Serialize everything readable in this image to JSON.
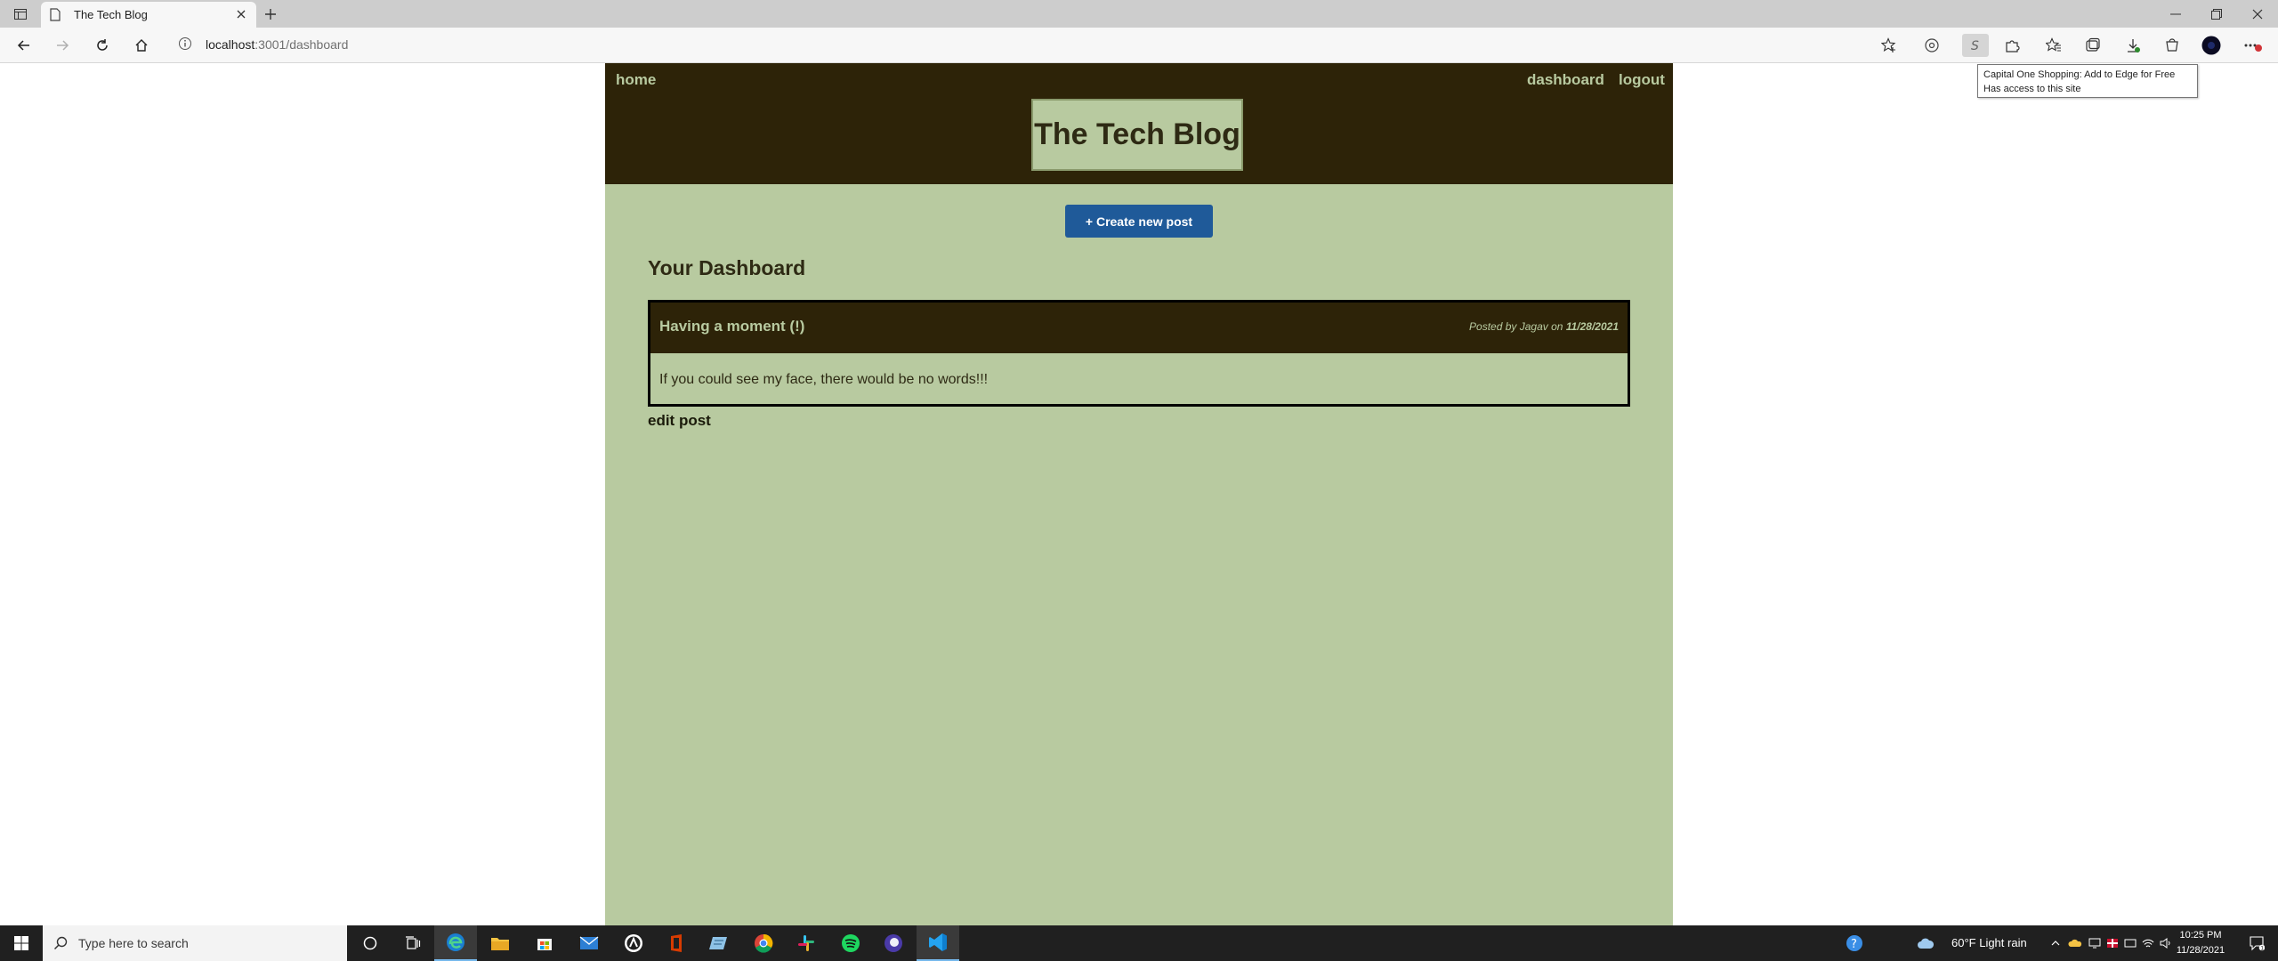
{
  "browser": {
    "tab_title": "The Tech Blog",
    "url_host": "localhost",
    "url_path": ":3001/dashboard",
    "extension_tooltip": {
      "line1": "Capital One Shopping: Add to Edge for Free",
      "line2": "Has access to this site"
    },
    "accent_color": "#1f5a99"
  },
  "site": {
    "nav": {
      "home": "home",
      "dashboard": "dashboard",
      "logout": "logout"
    },
    "title": "The Tech Blog",
    "create_button": "+ Create new post",
    "dashboard_title": "Your Dashboard",
    "posts": [
      {
        "title": "Having a moment (!)",
        "posted_by_prefix": "Posted by",
        "author": "Jagav",
        "on_word": "on",
        "date": "11/28/2021",
        "body": "If you could see my face, there would be no words!!!"
      }
    ],
    "edit_link": "edit post",
    "colors": {
      "header_bg": "#2d2308",
      "page_bg": "#b8caa0",
      "button_bg": "#1f5a99"
    }
  },
  "taskbar": {
    "search_placeholder": "Type here to search",
    "weather": "60°F  Light rain",
    "time": "10:25 PM",
    "date": "11/28/2021",
    "pinned_icons": [
      "cortana-icon",
      "task-view-icon",
      "edge-icon",
      "file-explorer-icon",
      "store-icon",
      "mail-icon",
      "app-icon",
      "office-icon",
      "notepad-icon",
      "chrome-icon",
      "slack-icon",
      "spotify-icon",
      "browser-icon",
      "vscode-icon"
    ]
  }
}
